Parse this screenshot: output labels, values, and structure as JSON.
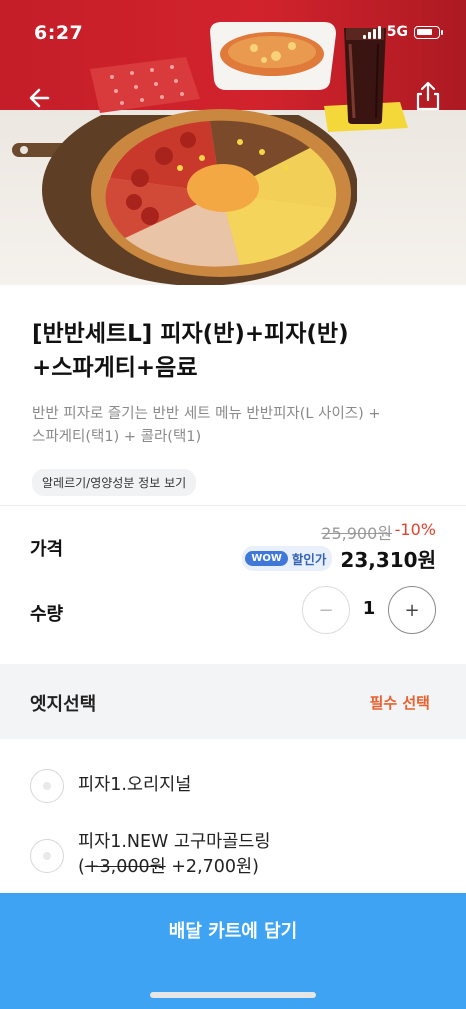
{
  "status_bar": {
    "time": "6:27",
    "network": "5G"
  },
  "header": {
    "back_icon": "arrow-left-icon",
    "share_icon": "share-icon"
  },
  "product": {
    "title_line1": "[반반세트L] 피자(반)+피자(반)",
    "title_line2": "+스파게티+음료",
    "desc_line1": "반반 피자로 즐기는 반반 세트 메뉴 반반피자(L 사이즈) +",
    "desc_line2": "스파게티(택1) + 콜라(택1)",
    "allergy_chip": "알레르기/영양성분 정보 보기"
  },
  "price": {
    "label": "가격",
    "original": "25,900원",
    "discount": "-10%",
    "wow_badge": "WOW",
    "wow_text": "할인가",
    "final": "23,310원"
  },
  "quantity": {
    "label": "수량",
    "minus": "−",
    "value": "1",
    "plus": "+"
  },
  "option_group": {
    "title": "엣지선택",
    "required": "필수 선택",
    "options": [
      {
        "label": "피자1.오리지널"
      },
      {
        "label": "피자1.NEW 고구마골드링",
        "open_paren": "(",
        "strike_price": "+3,000원",
        "price": " +2,700원)"
      }
    ]
  },
  "cta": {
    "label": "배달 카트에 담기"
  },
  "colors": {
    "accent_blue": "#3ea3f3",
    "discount_red": "#e8402f",
    "required_orange": "#e8612f",
    "wow_blue": "#3f78d8"
  }
}
